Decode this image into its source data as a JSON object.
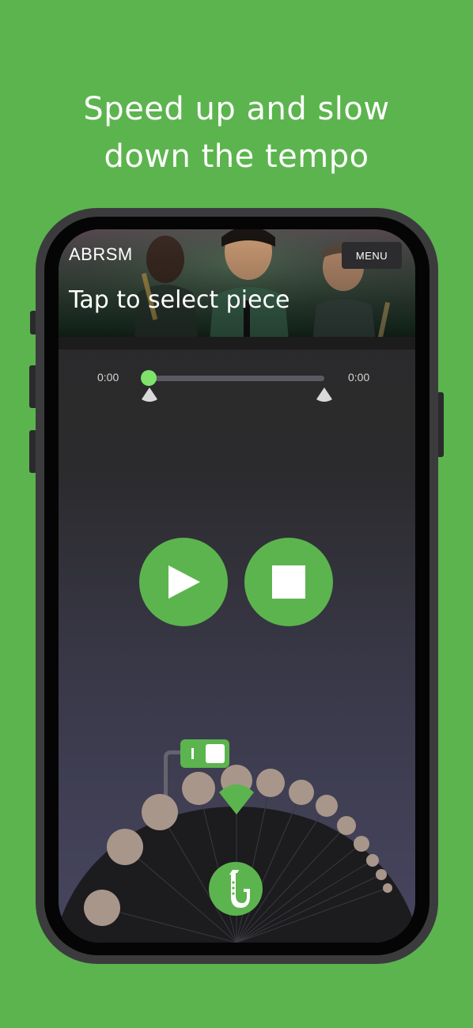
{
  "headline": {
    "line1": "Speed up and slow",
    "line2": "down the tempo"
  },
  "app": {
    "brand": "ABRSM",
    "menu_label": "MENU",
    "select_piece_label": "Tap to select piece"
  },
  "player": {
    "time_elapsed": "0:00",
    "time_total": "0:00",
    "progress": 0,
    "play_icon": "play-icon",
    "stop_icon": "stop-icon"
  },
  "tempo_dial": {
    "selector_icon": "triangle-pointer-icon",
    "instrument_icon": "saxophone-icon",
    "toggle_state": "on",
    "selected_index": 5
  },
  "colors": {
    "background": "#5cb44e",
    "accent": "#5cb44e",
    "playhead": "#7de36a",
    "tempo_dot": "#a8968a",
    "screen": "#2a2a2a"
  }
}
